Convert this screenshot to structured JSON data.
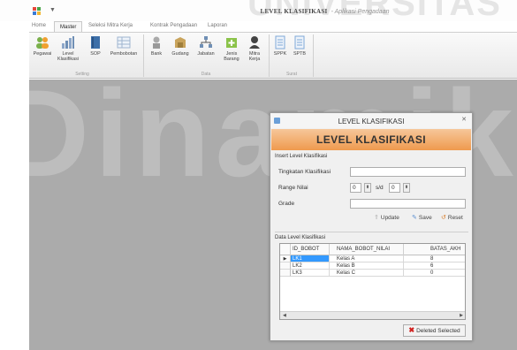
{
  "window": {
    "title": "LEVEL KLASIFIKASI",
    "subtitle": "- Aplikasi Pengadaan"
  },
  "menu": {
    "tabs": [
      {
        "label": "Home"
      },
      {
        "label": "Master"
      },
      {
        "label": "Seleksi Mitra Kerja"
      },
      {
        "label": "Kontrak Pengadaan"
      },
      {
        "label": "Laporan"
      }
    ]
  },
  "ribbon": {
    "buttons": [
      {
        "label": "Pegawai",
        "icon": "users-icon",
        "color": "#7ab04a"
      },
      {
        "label": "Level Klasifikasi",
        "icon": "chart-icon",
        "color": "#8da7c9"
      },
      {
        "label": "SOP",
        "icon": "book-icon",
        "color": "#3d6fa8"
      },
      {
        "label": "Pembobotan",
        "icon": "table-icon",
        "color": "#9fb5cf"
      },
      {
        "label": "Bank",
        "icon": "bank-icon",
        "color": "#9a9a9a"
      },
      {
        "label": "Gudang",
        "icon": "warehouse-icon",
        "color": "#c9a45c"
      },
      {
        "label": "Jabatan",
        "icon": "org-icon",
        "color": "#6f8fb5"
      },
      {
        "label": "Jenis Barang",
        "icon": "box-add-icon",
        "color": "#8bc34a"
      },
      {
        "label": "Mitra Kerja",
        "icon": "person-icon",
        "color": "#444444"
      },
      {
        "label": "SPPK",
        "icon": "doc-icon",
        "color": "#7fa8d8"
      },
      {
        "label": "SPTB",
        "icon": "doc-icon",
        "color": "#7fa8d8"
      }
    ],
    "groups": [
      {
        "label": "Setting"
      },
      {
        "label": "Data"
      },
      {
        "label": "Surat"
      }
    ]
  },
  "watermark": {
    "top": "UNIVERSITAS",
    "big": "Dinamika"
  },
  "dialog": {
    "title": "LEVEL KLASIFIKASI",
    "banner": "LEVEL KLASIFIKASI",
    "insert": {
      "section_title": "Insert Level Klasifikasi",
      "tingkatan_label": "Tingkatan Klasifikasi",
      "tingkatan_value": "",
      "range_label": "Range Nilai",
      "range_from": "0",
      "range_sep": "s/d",
      "range_to": "0",
      "grade_label": "Grade",
      "grade_value": ""
    },
    "buttons": {
      "update": "Update",
      "save": "Save",
      "reset": "Reset"
    },
    "data": {
      "section_title": "Data Level Klasifikasi",
      "columns": [
        "ID_BOBOT",
        "NAMA_BOBOT_NILAI",
        "BATAS_AKH"
      ],
      "rows": [
        {
          "id": "LK1",
          "nama": "Kelas A",
          "batas": "8"
        },
        {
          "id": "LK2",
          "nama": "Kelas B",
          "batas": "6"
        },
        {
          "id": "LK3",
          "nama": "Kelas C",
          "batas": "0"
        }
      ],
      "delete_button": "Deleted Selected"
    }
  },
  "colors": {
    "banner": "#ef9a4e",
    "selection": "#3399ff",
    "workspace": "#ababab",
    "delete_x": "#d0201e"
  }
}
